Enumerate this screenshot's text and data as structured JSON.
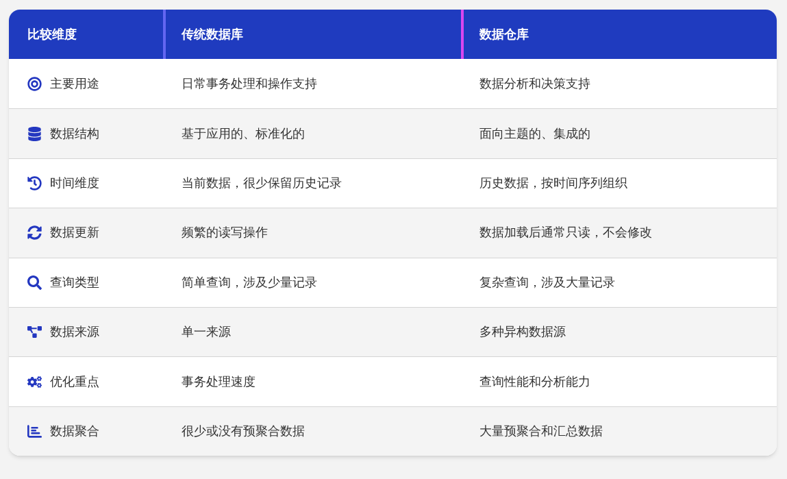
{
  "table": {
    "columns": [
      {
        "label": "比较维度"
      },
      {
        "label": "传统数据库"
      },
      {
        "label": "数据仓库"
      }
    ],
    "rows": [
      {
        "dimension": "主要用途",
        "traditional": "日常事务处理和操作支持",
        "warehouse": "数据分析和决策支持"
      },
      {
        "dimension": "数据结构",
        "traditional": "基于应用的、标准化的",
        "warehouse": "面向主题的、集成的"
      },
      {
        "dimension": "时间维度",
        "traditional": "当前数据，很少保留历史记录",
        "warehouse": "历史数据，按时间序列组织"
      },
      {
        "dimension": "数据更新",
        "traditional": "频繁的读写操作",
        "warehouse": "数据加载后通常只读，不会修改"
      },
      {
        "dimension": "查询类型",
        "traditional": "简单查询，涉及少量记录",
        "warehouse": "复杂查询，涉及大量记录"
      },
      {
        "dimension": "数据来源",
        "traditional": "单一来源",
        "warehouse": "多种异构数据源"
      },
      {
        "dimension": "优化重点",
        "traditional": "事务处理速度",
        "warehouse": "查询性能和分析能力"
      },
      {
        "dimension": "数据聚合",
        "traditional": "很少或没有预聚合数据",
        "warehouse": "大量预聚合和汇总数据"
      }
    ]
  }
}
